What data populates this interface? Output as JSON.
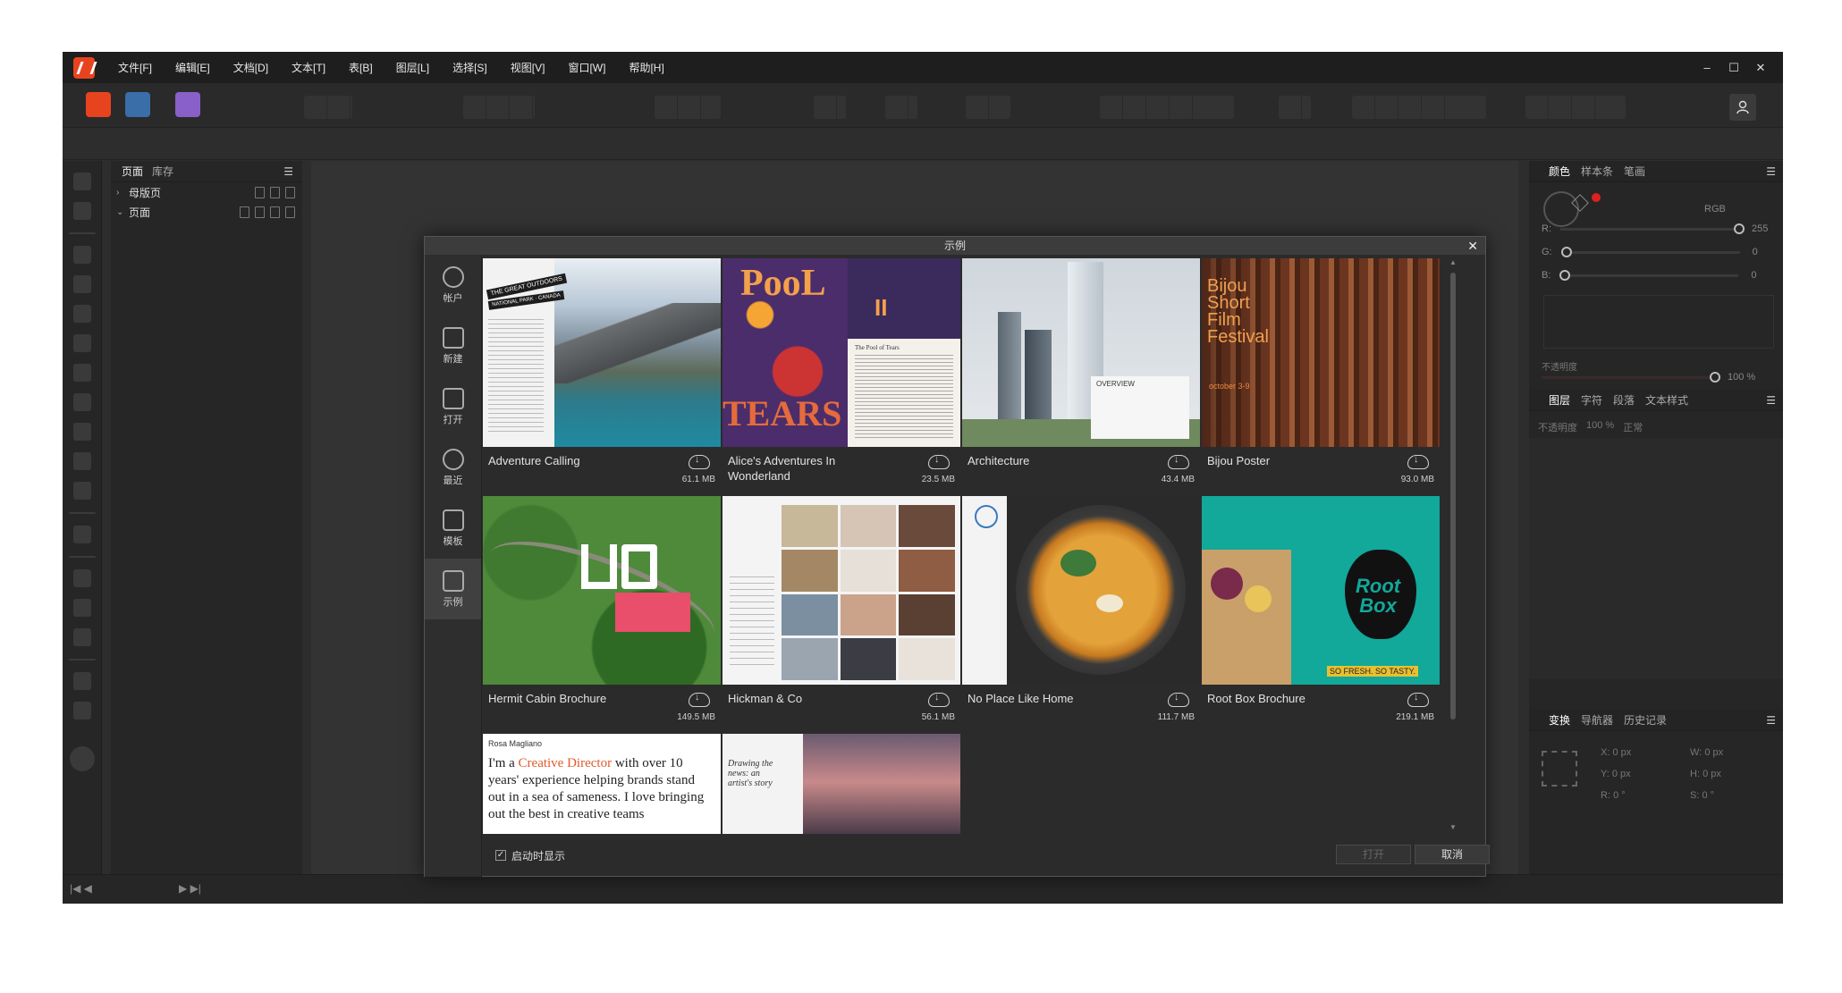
{
  "menubar": {
    "items": [
      "文件[F]",
      "编辑[E]",
      "文档[D]",
      "文本[T]",
      "表[B]",
      "图层[L]",
      "选择[S]",
      "视图[V]",
      "窗口[W]",
      "帮助[H]"
    ],
    "window_controls": [
      "–",
      "☐",
      "✕"
    ]
  },
  "pages_panel": {
    "tabs": [
      "页面",
      "库存"
    ],
    "rows": [
      {
        "chev": "›",
        "label": "母版页"
      },
      {
        "chev": "⌄",
        "label": "页面"
      }
    ]
  },
  "right_panel": {
    "color_tabs": [
      "颜色",
      "样本条",
      "笔画"
    ],
    "color_mode": "RGB",
    "r_label": "R:",
    "r_value": "255",
    "g_label": "G:",
    "g_value": "0",
    "b_label": "B:",
    "b_value": "0",
    "opacity_label": "不透明度",
    "opacity_value": "100 %",
    "layer_tabs": [
      "图层",
      "字符",
      "段落",
      "文本样式"
    ],
    "layer_opacity_label": "不透明度",
    "layer_opacity_value": "100 %",
    "blend_mode": "正常",
    "transform_tabs": [
      "变换",
      "导航器",
      "历史记录"
    ],
    "x_label": "X:",
    "x_value": "0 px",
    "y_label": "Y:",
    "y_value": "0 px",
    "w_label": "W:",
    "w_value": "0 px",
    "h_label": "H:",
    "h_value": "0 px",
    "r_rot_label": "R:",
    "r_rot_value": "0 °",
    "s_label": "S:",
    "s_value": "0 °"
  },
  "dialog": {
    "title": "示例",
    "close": "✕",
    "sidebar": [
      {
        "label": "帐户",
        "icon": "account-icon"
      },
      {
        "label": "新建",
        "icon": "new-document-icon"
      },
      {
        "label": "打开",
        "icon": "folder-icon"
      },
      {
        "label": "最近",
        "icon": "clock-icon"
      },
      {
        "label": "模板",
        "icon": "template-icon"
      },
      {
        "label": "示例",
        "icon": "image-icon"
      }
    ],
    "samples": [
      {
        "title": "Adventure Calling",
        "size": "61.1 MB"
      },
      {
        "title": "Alice's Adventures In Wonderland",
        "size": "23.5 MB"
      },
      {
        "title": "Architecture",
        "size": "43.4 MB"
      },
      {
        "title": "Bijou Poster",
        "size": "93.0 MB"
      },
      {
        "title": "Hermit Cabin Brochure",
        "size": "149.5 MB"
      },
      {
        "title": "Hickman & Co",
        "size": "56.1 MB"
      },
      {
        "title": "No Place Like Home",
        "size": "111.7 MB"
      },
      {
        "title": "Root Box Brochure",
        "size": "219.1 MB"
      }
    ],
    "thumb_text": {
      "adventure_banner": "THE GREAT OUTDOORS",
      "adventure_sub": "NATIONAL PARK · CANADA",
      "pool": "PooL",
      "tears": "TEARS",
      "pool_ii": "II",
      "pool_page": "The Pool of Tears",
      "overview": "OVERVIEW",
      "bijou": "Bijou",
      "short": "Short",
      "film": "Film",
      "festival": "Festival",
      "october": "october 3-9",
      "root": "Root",
      "box": "Box",
      "so_fresh": "SO FRESH. SO TASTY.",
      "rosa": "Rosa Magliano",
      "quote_a": "I'm a ",
      "quote_hl": "Creative Director",
      "quote_b": " with over 10 years' experience helping brands stand out in a sea of sameness. I love bringing out the best in creative teams",
      "drawing": "Drawing the news: an artist's story"
    },
    "show_on_start": "启动时显示",
    "open_button": "打开",
    "cancel_button": "取消"
  }
}
